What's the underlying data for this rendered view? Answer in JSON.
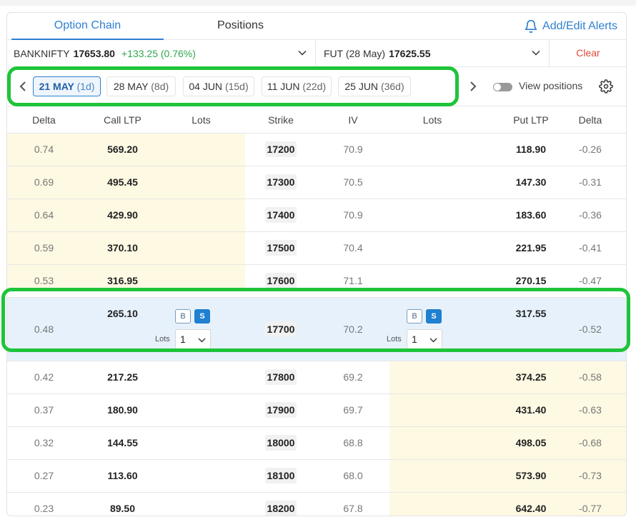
{
  "tabs": {
    "option_chain": "Option Chain",
    "positions": "Positions"
  },
  "alerts_label": "Add/Edit Alerts",
  "instrument": {
    "name": "BANKNIFTY",
    "ltp": "17653.80",
    "change": "+133.25 (0.76%)"
  },
  "future": {
    "name": "FUT (28 May)",
    "ltp": "17625.55"
  },
  "clear_label": "Clear",
  "expiries": [
    {
      "date": "21 MAY",
      "days": "(1d)"
    },
    {
      "date": "28 MAY",
      "days": "(8d)"
    },
    {
      "date": "04 JUN",
      "days": "(15d)"
    },
    {
      "date": "11 JUN",
      "days": "(22d)"
    },
    {
      "date": "25 JUN",
      "days": "(36d)"
    }
  ],
  "view_positions_label": "View positions",
  "headers": [
    "Delta",
    "Call LTP",
    "Lots",
    "Strike",
    "IV",
    "Lots",
    "Put LTP",
    "Delta"
  ],
  "rows": [
    {
      "call_delta": "0.74",
      "call_ltp": "569.20",
      "strike": "17200",
      "iv": "70.9",
      "put_ltp": "118.90",
      "put_delta": "-0.26"
    },
    {
      "call_delta": "0.69",
      "call_ltp": "495.45",
      "strike": "17300",
      "iv": "70.5",
      "put_ltp": "147.30",
      "put_delta": "-0.31"
    },
    {
      "call_delta": "0.64",
      "call_ltp": "429.90",
      "strike": "17400",
      "iv": "70.9",
      "put_ltp": "183.60",
      "put_delta": "-0.36"
    },
    {
      "call_delta": "0.59",
      "call_ltp": "370.10",
      "strike": "17500",
      "iv": "70.4",
      "put_ltp": "221.95",
      "put_delta": "-0.41"
    },
    {
      "call_delta": "0.53",
      "call_ltp": "316.95",
      "strike": "17600",
      "iv": "71.1",
      "put_ltp": "270.15",
      "put_delta": "-0.47"
    },
    {
      "call_delta": "0.48",
      "call_ltp": "265.10",
      "strike": "17700",
      "iv": "70.2",
      "put_ltp": "317.55",
      "put_delta": "-0.52"
    },
    {
      "call_delta": "0.42",
      "call_ltp": "217.25",
      "strike": "17800",
      "iv": "69.2",
      "put_ltp": "374.25",
      "put_delta": "-0.58"
    },
    {
      "call_delta": "0.37",
      "call_ltp": "180.90",
      "strike": "17900",
      "iv": "69.7",
      "put_ltp": "431.40",
      "put_delta": "-0.63"
    },
    {
      "call_delta": "0.32",
      "call_ltp": "144.55",
      "strike": "18000",
      "iv": "68.8",
      "put_ltp": "498.05",
      "put_delta": "-0.68"
    },
    {
      "call_delta": "0.27",
      "call_ltp": "113.60",
      "strike": "18100",
      "iv": "68.0",
      "put_ltp": "573.90",
      "put_delta": "-0.73"
    },
    {
      "call_delta": "0.23",
      "call_ltp": "89.50",
      "strike": "18200",
      "iv": "67.8",
      "put_ltp": "642.40",
      "put_delta": "-0.77"
    }
  ],
  "order": {
    "buy": "B",
    "sell": "S",
    "lots_label": "Lots",
    "lots_value": "1"
  },
  "colors": {
    "accent": "#2f80d1",
    "positive": "#2fa84f",
    "clear": "#e04a3a",
    "itm_bg": "#fdf9e3",
    "atm_bg": "#e6f1fb",
    "highlight": "#1ec43a"
  }
}
